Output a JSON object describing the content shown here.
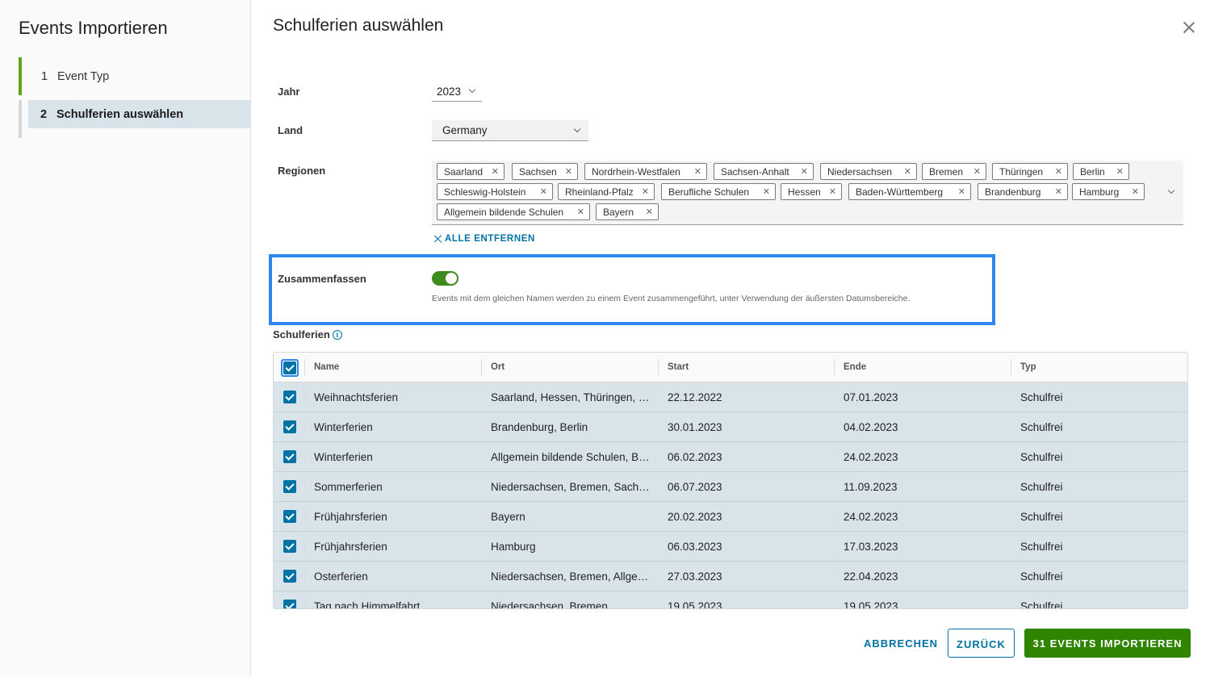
{
  "sidebar": {
    "title": "Events Importieren",
    "steps": [
      {
        "num": "1",
        "label": "Event Typ"
      },
      {
        "num": "2",
        "label": "Schulferien auswählen"
      }
    ]
  },
  "main": {
    "title": "Schulferien auswählen",
    "year": {
      "label": "Jahr",
      "value": "2023"
    },
    "country": {
      "label": "Land",
      "value": "Germany"
    },
    "regions": {
      "label": "Regionen",
      "tags": [
        "Saarland",
        "Sachsen",
        "Nordrhein-Westfalen",
        "Sachsen-Anhalt",
        "Niedersachsen",
        "Bremen",
        "Thüringen",
        "Berlin",
        "Schleswig-Holstein",
        "Rheinland-Pfalz",
        "Berufliche Schulen",
        "Hessen",
        "Baden-Württemberg",
        "Brandenburg",
        "Hamburg",
        "Allgemein bildende Schulen",
        "Bayern"
      ],
      "remove_all": "ALLE ENTFERNEN"
    },
    "merge": {
      "label": "Zusammenfassen",
      "enabled": true,
      "help": "Events mit dem gleichen Namen werden zu einem Event zusammengeführt, unter Verwendung der äußersten Datumsbereiche."
    },
    "table": {
      "section_label": "Schulferien",
      "columns": [
        "Name",
        "Ort",
        "Start",
        "Ende",
        "Typ"
      ],
      "rows": [
        {
          "name": "Weihnachtsferien",
          "ort": "Saarland, Hessen, Thüringen, Berlin, Bremen",
          "start": "22.12.2022",
          "ende": "07.01.2023",
          "typ": "Schulfrei"
        },
        {
          "name": "Winterferien",
          "ort": "Brandenburg, Berlin",
          "start": "30.01.2023",
          "ende": "04.02.2023",
          "typ": "Schulfrei"
        },
        {
          "name": "Winterferien",
          "ort": "Allgemein bildende Schulen, Berufliche Schulen",
          "start": "06.02.2023",
          "ende": "24.02.2023",
          "typ": "Schulfrei"
        },
        {
          "name": "Sommerferien",
          "ort": "Niedersachsen, Bremen, Sachsen-Anhalt",
          "start": "06.07.2023",
          "ende": "11.09.2023",
          "typ": "Schulfrei"
        },
        {
          "name": "Frühjahrsferien",
          "ort": "Bayern",
          "start": "20.02.2023",
          "ende": "24.02.2023",
          "typ": "Schulfrei"
        },
        {
          "name": "Frühjahrsferien",
          "ort": "Hamburg",
          "start": "06.03.2023",
          "ende": "17.03.2023",
          "typ": "Schulfrei"
        },
        {
          "name": "Osterferien",
          "ort": "Niedersachsen, Bremen, Allgemein bildende Schulen",
          "start": "27.03.2023",
          "ende": "22.04.2023",
          "typ": "Schulfrei"
        },
        {
          "name": "Tag nach Himmelfahrt",
          "ort": "Niedersachsen, Bremen",
          "start": "19.05.2023",
          "ende": "19.05.2023",
          "typ": "Schulfrei"
        }
      ]
    }
  },
  "footer": {
    "cancel": "ABBRECHEN",
    "back": "ZURÜCK",
    "import": "31 EVENTS IMPORTIEREN"
  },
  "colors": {
    "accent_blue": "#0072a3",
    "primary_green": "#2f8400",
    "highlight": "#2e86f0",
    "row_selected": "#d9e4ea"
  }
}
